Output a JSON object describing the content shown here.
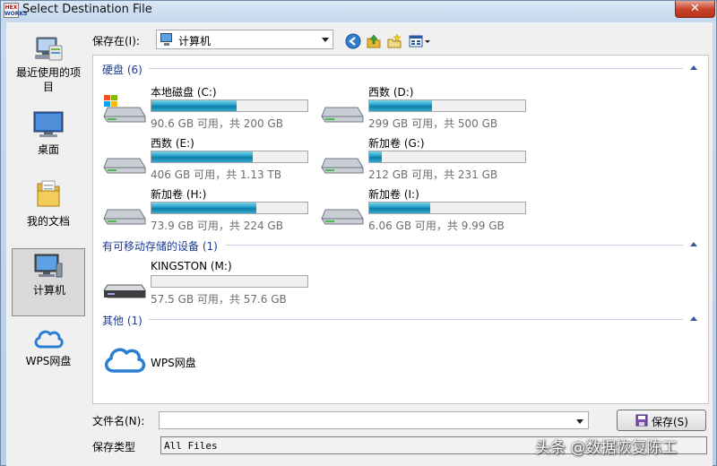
{
  "window": {
    "title": "Select Destination File",
    "app_icon_text_top": "HEX",
    "app_icon_text_bottom": "WORKS",
    "close_label": "✕"
  },
  "places": [
    {
      "label": "最近使用的项目",
      "icon": "recent-places-icon"
    },
    {
      "label": "桌面",
      "icon": "desktop-icon"
    },
    {
      "label": "我的文档",
      "icon": "documents-folder-icon"
    },
    {
      "label": "计算机",
      "icon": "computer-icon",
      "selected": true
    },
    {
      "label": "WPS网盘",
      "icon": "wps-cloud-icon"
    }
  ],
  "toolbar": {
    "save_in_label": "保存在(I):",
    "location": "计算机"
  },
  "groups": {
    "hard_disks": {
      "header": "硬盘 (6)"
    },
    "removable": {
      "header": "有可移动存储的设备 (1)"
    },
    "other": {
      "header": "其他 (1)"
    }
  },
  "drives": [
    {
      "name": "本地磁盘 (C:)",
      "size_text": "90.6 GB 可用，共 200 GB",
      "used_fraction": 0.547,
      "system": true
    },
    {
      "name": "西数 (D:)",
      "size_text": "299 GB 可用，共 500 GB",
      "used_fraction": 0.402
    },
    {
      "name": "西数 (E:)",
      "size_text": "406 GB 可用，共 1.13 TB",
      "used_fraction": 0.649
    },
    {
      "name": "新加卷 (G:)",
      "size_text": "212 GB 可用，共 231 GB",
      "used_fraction": 0.082
    },
    {
      "name": "新加卷 (H:)",
      "size_text": "73.9 GB 可用，共 224 GB",
      "used_fraction": 0.67
    },
    {
      "name": "新加卷 (I:)",
      "size_text": "6.06 GB 可用，共 9.99 GB",
      "used_fraction": 0.393
    },
    {
      "name": "KINGSTON (M:)",
      "size_text": "57.5 GB 可用，共 57.6 GB",
      "used_fraction": 0.002,
      "removable": true
    }
  ],
  "other_items": [
    {
      "label": "WPS网盘"
    }
  ],
  "bottom": {
    "filename_label": "文件名(N):",
    "filename_value": "",
    "filetype_label": "保存类型",
    "filetype_value": "All Files",
    "save_button": "保存(S)"
  },
  "watermark": "头条 @数据恢复陈工",
  "colors": {
    "accent": "#1e3a8c",
    "bar_fill": "#1f9cc4",
    "group_line": "#c5d2e6"
  }
}
